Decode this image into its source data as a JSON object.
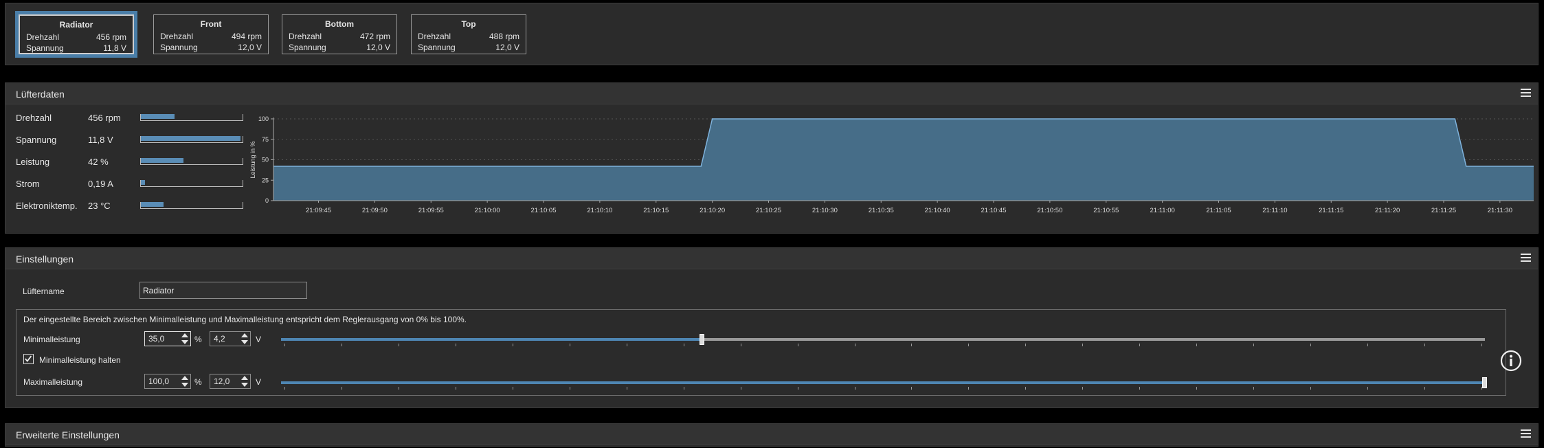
{
  "fans": [
    {
      "name": "Radiator",
      "speed_label": "Drehzahl",
      "speed": "456 rpm",
      "voltage_label": "Spannung",
      "voltage": "11,8 V"
    },
    {
      "name": "Front",
      "speed_label": "Drehzahl",
      "speed": "494 rpm",
      "voltage_label": "Spannung",
      "voltage": "12,0 V"
    },
    {
      "name": "Bottom",
      "speed_label": "Drehzahl",
      "speed": "472 rpm",
      "voltage_label": "Spannung",
      "voltage": "12,0 V"
    },
    {
      "name": "Top",
      "speed_label": "Drehzahl",
      "speed": "488 rpm",
      "voltage_label": "Spannung",
      "voltage": "12,0 V"
    }
  ],
  "fan_data": {
    "title": "Lüfterdaten",
    "metrics": [
      {
        "label": "Drehzahl",
        "value": "456 rpm",
        "fraction": 0.33
      },
      {
        "label": "Spannung",
        "value": "11,8 V",
        "fraction": 0.98
      },
      {
        "label": "Leistung",
        "value": "42 %",
        "fraction": 0.42
      },
      {
        "label": "Strom",
        "value": "0,19 A",
        "fraction": 0.04
      },
      {
        "label": "Elektroniktemp.",
        "value": "23 °C",
        "fraction": 0.22
      }
    ]
  },
  "chart_data": {
    "type": "area",
    "ylabel": "Leistung in %",
    "ylim": [
      0,
      100
    ],
    "yticks": [
      0,
      25,
      50,
      75,
      100
    ],
    "xticks": [
      "21:09:45",
      "21:09:50",
      "21:09:55",
      "21:10:00",
      "21:10:05",
      "21:10:10",
      "21:10:15",
      "21:10:20",
      "21:10:25",
      "21:10:30",
      "21:10:35",
      "21:10:40",
      "21:10:45",
      "21:10:50",
      "21:10:55",
      "21:11:00",
      "21:11:05",
      "21:11:10",
      "21:11:15",
      "21:11:20",
      "21:11:25",
      "21:11:30"
    ],
    "series": [
      {
        "points": [
          {
            "t": "21:09:41",
            "y": 42
          },
          {
            "t": "21:10:19",
            "y": 42
          },
          {
            "t": "21:10:20",
            "y": 100
          },
          {
            "t": "21:11:26",
            "y": 100
          },
          {
            "t": "21:11:27",
            "y": 42
          },
          {
            "t": "21:11:33",
            "y": 42
          }
        ]
      }
    ],
    "fill_color": "#466d88",
    "line_color": "#7fb3dd",
    "grid": true
  },
  "settings": {
    "title": "Einstellungen",
    "name_label": "Lüftername",
    "name_value": "Radiator",
    "info_text": "Der eingestellte Bereich zwischen Minimalleistung und Maximalleistung entspricht dem Reglerausgang von 0% bis 100%.",
    "min_label": "Minimalleistung",
    "min_percent": "35,0",
    "min_volt": "4,2",
    "min_fraction": 0.35,
    "hold_min_label": "Minimalleistung halten",
    "hold_min_checked": true,
    "max_label": "Maximalleistung",
    "max_percent": "100,0",
    "max_volt": "12,0",
    "max_fraction": 1.0,
    "percent_unit": "%",
    "volt_unit": "V",
    "info_icon": "info-circle-icon"
  },
  "advanced": {
    "title": "Erweiterte Einstellungen"
  }
}
